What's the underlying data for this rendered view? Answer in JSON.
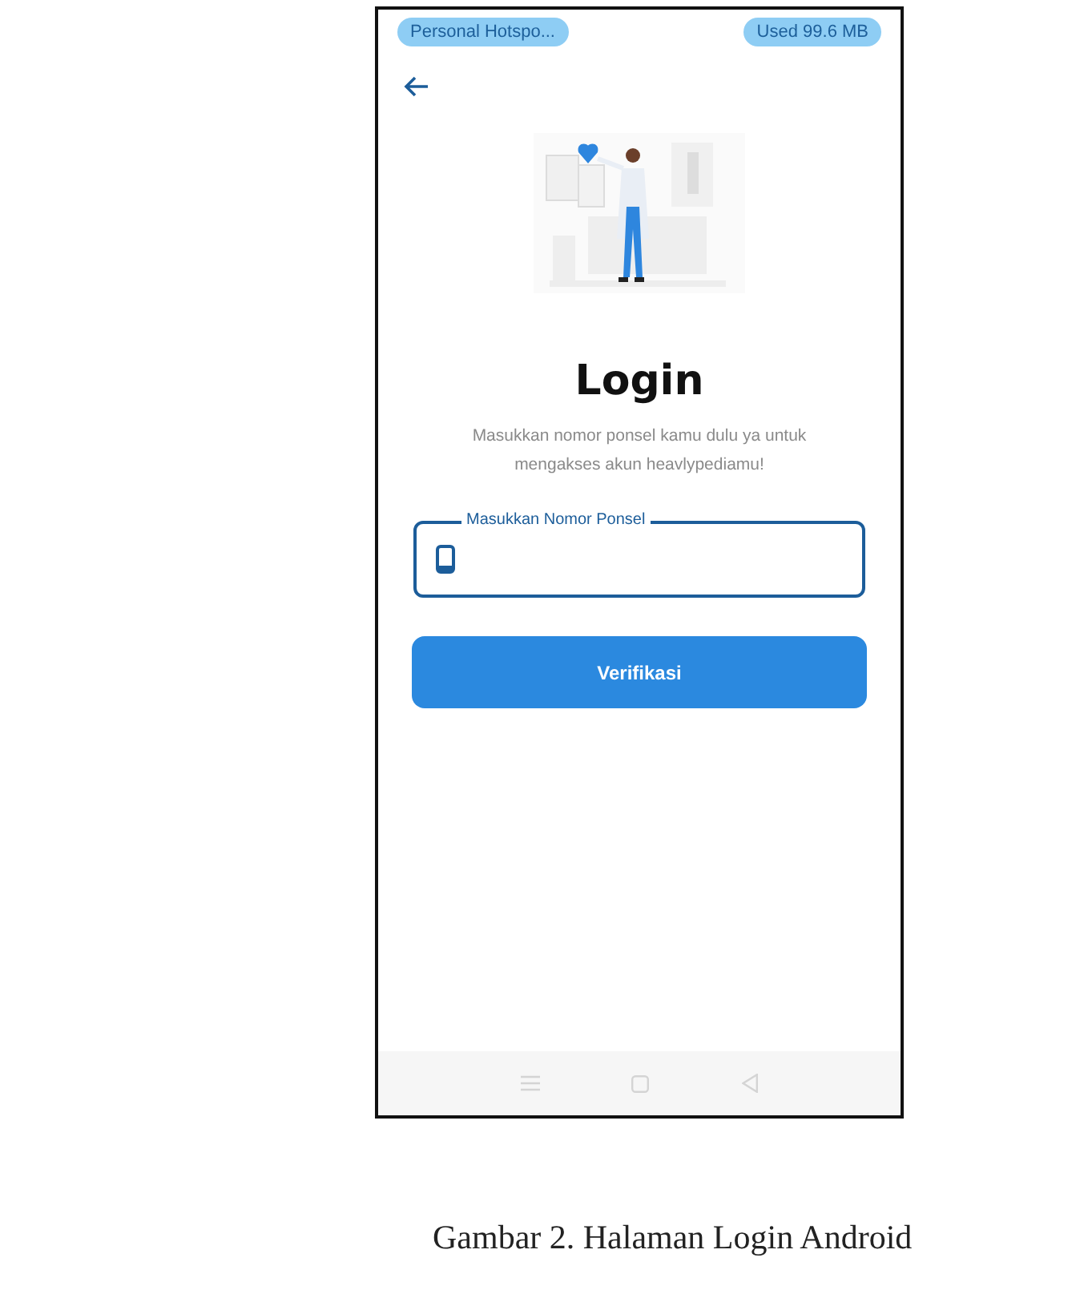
{
  "status_bar": {
    "hotspot": "Personal Hotspo...",
    "data_used": "Used  99.6 MB"
  },
  "login": {
    "title": "Login",
    "subtitle": "Masukkan nomor ponsel kamu dulu ya untuk mengakses akun heavlypediamu!",
    "phone_field": {
      "label": "Masukkan Nomor Ponsel"
    },
    "button": "Verifikasi"
  },
  "caption": "Gambar 2. Halaman Login Android"
}
